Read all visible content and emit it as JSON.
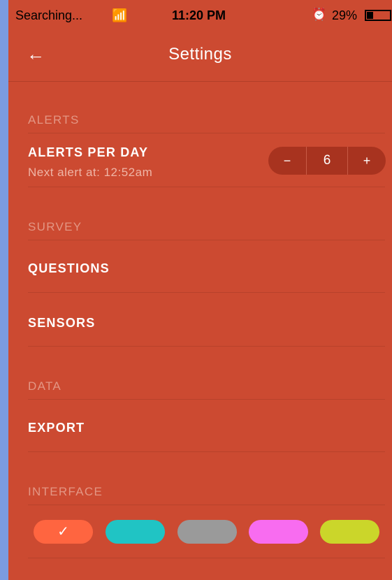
{
  "status_bar": {
    "carrier": "Searching...",
    "wifi_icon": "wifi-icon",
    "time": "11:20 PM",
    "alarm_icon": "alarm-clock-icon",
    "battery": "29%"
  },
  "nav": {
    "back_icon": "←",
    "title": "Settings"
  },
  "sections": {
    "alerts": "ALERTS",
    "survey": "SURVEY",
    "data": "DATA",
    "interface": "INTERFACE"
  },
  "alerts": {
    "label": "ALERTS PER DAY",
    "next_alert": "Next alert at: 12:52am",
    "stepper": {
      "minus": "−",
      "value": "6",
      "plus": "+"
    }
  },
  "survey": {
    "questions": "QUESTIONS",
    "sensors": "SENSORS"
  },
  "data": {
    "export": "EXPORT"
  },
  "interface": {
    "selected_check": "✓",
    "colors": [
      "#ff6540",
      "#20c4c4",
      "#9a9a9a",
      "#f86cf0",
      "#cbd62a"
    ]
  }
}
